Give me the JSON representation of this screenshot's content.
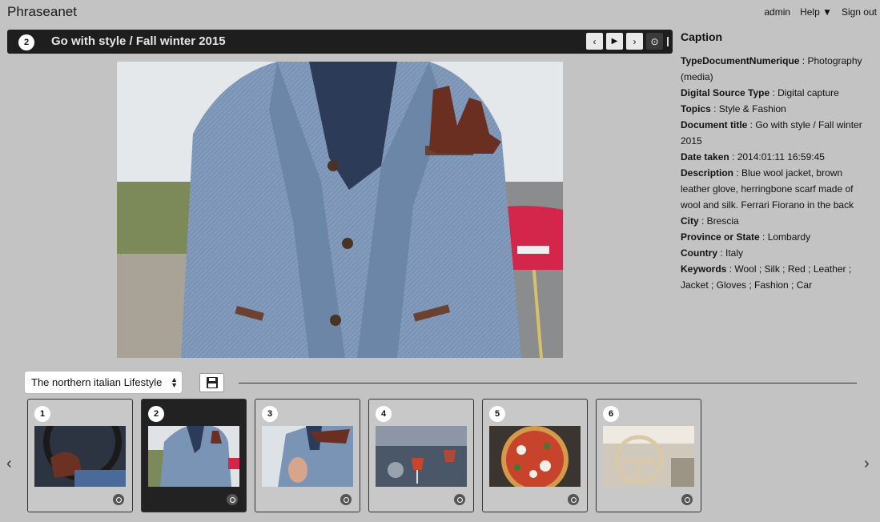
{
  "app": {
    "title": "Phraseanet"
  },
  "topnav": {
    "user": "admin",
    "help": "Help ▼",
    "signout": "Sign out"
  },
  "viewer": {
    "record_number": "2",
    "record_title": "Go with style / Fall winter 2015",
    "controls": {
      "prev": "‹",
      "play": "▶",
      "next": "›",
      "options": "⊙"
    }
  },
  "caption": {
    "heading": "Caption",
    "fields": [
      {
        "label": "TypeDocumentNumerique",
        "value": " : Photography (media)"
      },
      {
        "label": "Digital Source Type",
        "value": " : Digital capture"
      },
      {
        "label": "Topics",
        "value": " : Style & Fashion"
      },
      {
        "label": "Document title",
        "value": " : Go with style / Fall winter 2015"
      },
      {
        "label": "Date taken",
        "value": " : 2014:01:11 16:59:45"
      },
      {
        "label": "Description",
        "value": " : Blue wool jacket, brown leather glove, herringbone scarf made of wool and silk. Ferrari Fiorano in the back"
      },
      {
        "label": "City",
        "value": " : Brescia"
      },
      {
        "label": "Province or State",
        "value": " : Lombardy"
      },
      {
        "label": "Country",
        "value": " : Italy"
      },
      {
        "label": "Keywords",
        "value": " : Wool ; Silk ; Red ; Leather ; Jacket ; Gloves ; Fashion ; Car"
      }
    ]
  },
  "basket": {
    "selected": "The northern italian Lifestyle",
    "save_icon": "floppy-disk-icon"
  },
  "thumbnails": {
    "prev_arrow": "‹",
    "next_arrow": "›",
    "items": [
      {
        "number": "1",
        "subject": "leather-gloves-steering-wheel"
      },
      {
        "number": "2",
        "subject": "blue-wool-jacket"
      },
      {
        "number": "3",
        "subject": "jacket-closeup"
      },
      {
        "number": "4",
        "subject": "wine-glasses"
      },
      {
        "number": "5",
        "subject": "pizza"
      },
      {
        "number": "6",
        "subject": "vintage-steering-wheel"
      }
    ],
    "active_index": 1
  }
}
